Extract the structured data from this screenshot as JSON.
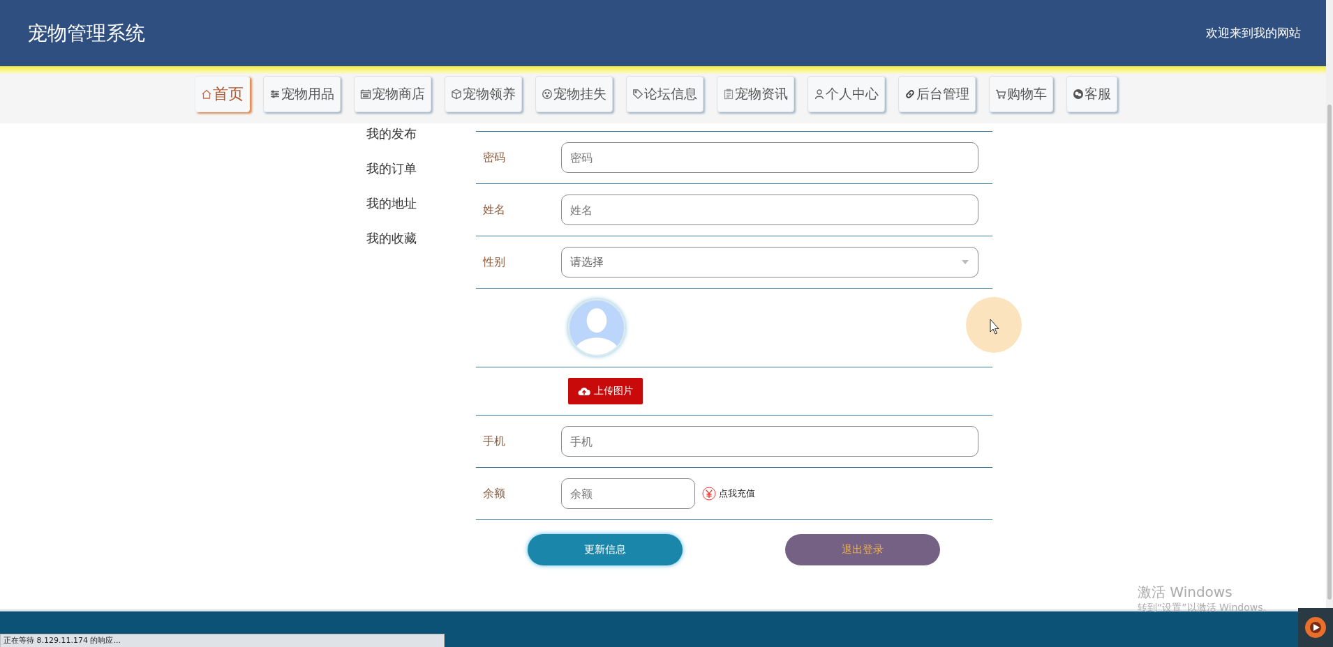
{
  "header": {
    "title": "宠物管理系统",
    "welcome": "欢迎来到我的网站"
  },
  "nav": [
    {
      "label": "首页",
      "selected": true
    },
    {
      "label": "宠物用品",
      "selected": false
    },
    {
      "label": "宠物商店",
      "selected": false
    },
    {
      "label": "宠物领养",
      "selected": false
    },
    {
      "label": "宠物挂失",
      "selected": false
    },
    {
      "label": "论坛信息",
      "selected": false
    },
    {
      "label": "宠物资讯",
      "selected": false
    },
    {
      "label": "个人中心",
      "selected": false
    },
    {
      "label": "后台管理",
      "selected": false
    },
    {
      "label": "购物车",
      "selected": false
    },
    {
      "label": "客服",
      "selected": false
    }
  ],
  "sidebar": {
    "items": [
      "我的发布",
      "我的订单",
      "我的地址",
      "我的收藏"
    ]
  },
  "form": {
    "rows": [
      {
        "kind": "input",
        "label": "密码",
        "placeholder": "密码"
      },
      {
        "kind": "input",
        "label": "姓名",
        "placeholder": "姓名"
      },
      {
        "kind": "select",
        "label": "性别",
        "placeholder": "请选择"
      },
      {
        "kind": "avatar"
      },
      {
        "kind": "upload",
        "button": "上传图片"
      },
      {
        "kind": "input",
        "label": "手机",
        "placeholder": "手机"
      },
      {
        "kind": "balance",
        "label": "余额",
        "placeholder": "余额",
        "link": "点我充值"
      }
    ],
    "buttons": [
      {
        "kind": "primary",
        "label": "更新信息"
      },
      {
        "kind": "logout",
        "label": "退出登录"
      }
    ]
  },
  "status_bar": {
    "text": "正在等待 8.129.11.174 的响应..."
  },
  "watermark": {
    "title": "激活 Windows",
    "hint": "转到“设置”以激活 Windows。"
  }
}
